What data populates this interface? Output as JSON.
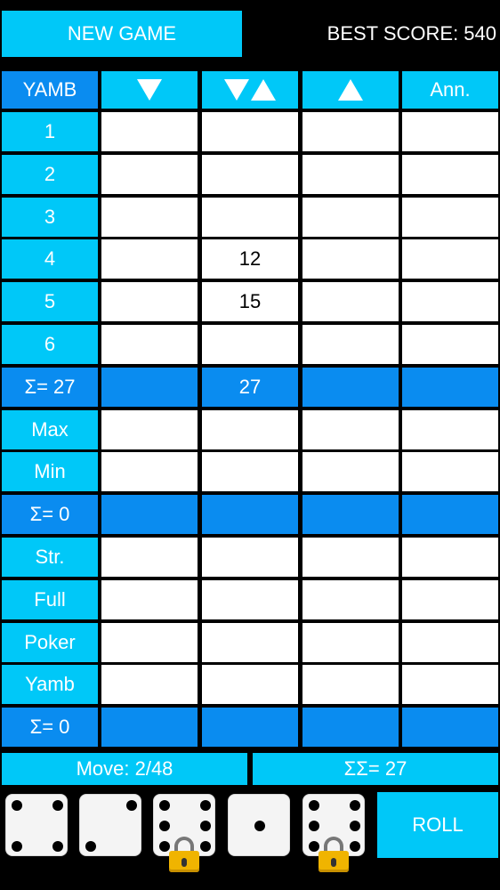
{
  "header": {
    "new_game_label": "NEW GAME",
    "best_score_label": "BEST SCORE: 540"
  },
  "columns": {
    "yamb": "YAMB",
    "down_icon": "down-arrow-icon",
    "updown_icon": "down-up-arrows-icon",
    "up_icon": "up-arrow-icon",
    "announce": "Ann."
  },
  "rows": [
    {
      "label": "1",
      "cells": [
        "",
        "",
        "",
        ""
      ]
    },
    {
      "label": "2",
      "cells": [
        "",
        "",
        "",
        ""
      ]
    },
    {
      "label": "3",
      "cells": [
        "",
        "",
        "",
        ""
      ]
    },
    {
      "label": "4",
      "cells": [
        "",
        "12",
        "",
        ""
      ]
    },
    {
      "label": "5",
      "cells": [
        "",
        "15",
        "",
        ""
      ]
    },
    {
      "label": "6",
      "cells": [
        "",
        "",
        "",
        ""
      ]
    },
    {
      "label": "Σ= 27",
      "cells": [
        "",
        "27",
        "",
        ""
      ],
      "sum": true
    },
    {
      "label": "Max",
      "cells": [
        "",
        "",
        "",
        ""
      ]
    },
    {
      "label": "Min",
      "cells": [
        "",
        "",
        "",
        ""
      ]
    },
    {
      "label": "Σ= 0",
      "cells": [
        "",
        "",
        "",
        ""
      ],
      "sum": true
    },
    {
      "label": "Str.",
      "cells": [
        "",
        "",
        "",
        ""
      ]
    },
    {
      "label": "Full",
      "cells": [
        "",
        "",
        "",
        ""
      ]
    },
    {
      "label": "Poker",
      "cells": [
        "",
        "",
        "",
        ""
      ]
    },
    {
      "label": "Yamb",
      "cells": [
        "",
        "",
        "",
        ""
      ]
    },
    {
      "label": "Σ= 0",
      "cells": [
        "",
        "",
        "",
        ""
      ],
      "sum": true
    }
  ],
  "footer": {
    "move_label": "Move: 2/48",
    "total_label": "ΣΣ= 27",
    "roll_label": "ROLL"
  },
  "dice": [
    {
      "value": 4,
      "locked": false
    },
    {
      "value": 2,
      "locked": false
    },
    {
      "value": 6,
      "locked": true
    },
    {
      "value": 1,
      "locked": false
    },
    {
      "value": 6,
      "locked": true
    }
  ],
  "colors": {
    "accent": "#00c8f8",
    "sum_row": "#0a8cf0",
    "background": "#000000",
    "lock": "#f0b400"
  }
}
